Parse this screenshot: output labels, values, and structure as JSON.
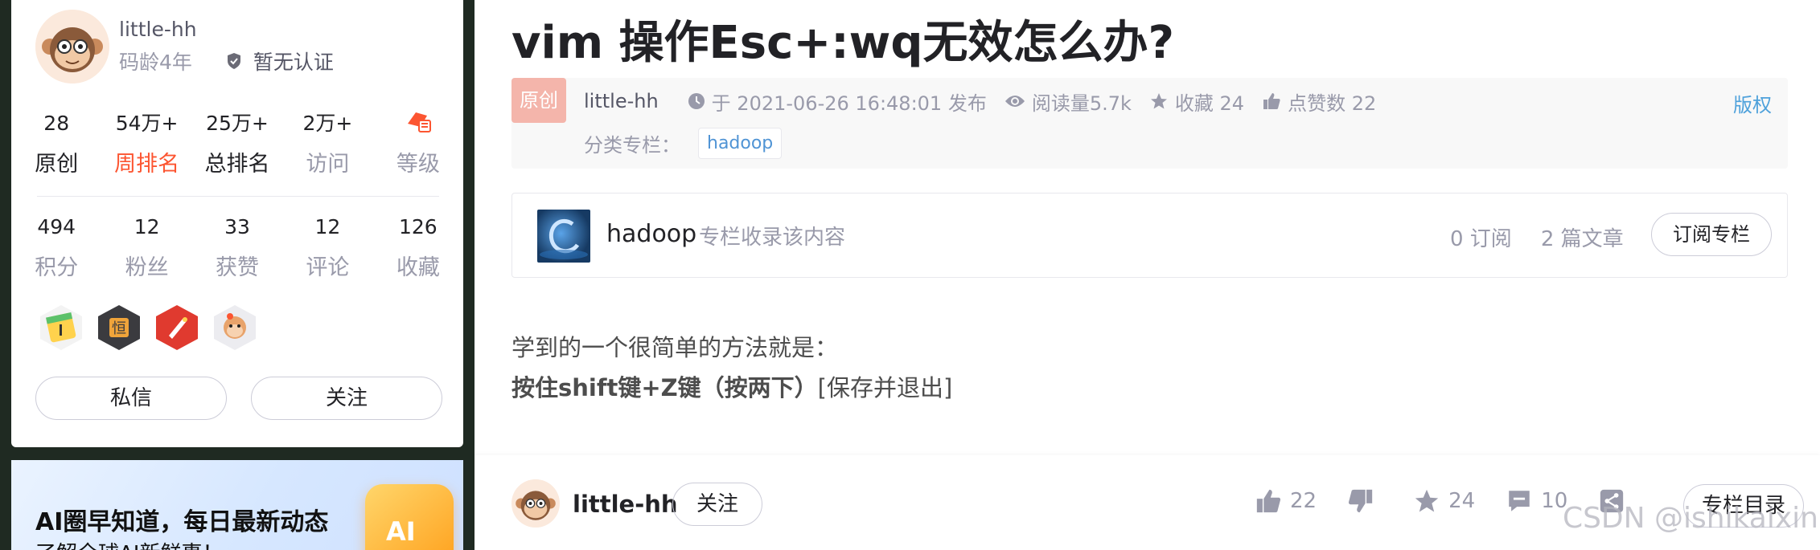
{
  "profile": {
    "name": "little-hh",
    "code_age": "码龄4年",
    "cert": "暂无认证",
    "stats_row1": [
      {
        "num": "28",
        "label": "原创",
        "style": "dark"
      },
      {
        "num": "54万+",
        "label": "周排名",
        "style": "red"
      },
      {
        "num": "25万+",
        "label": "总排名",
        "style": "dark"
      },
      {
        "num": "2万+",
        "label": "访问",
        "style": "gray"
      },
      {
        "num": "",
        "label": "等级",
        "style": "gray"
      }
    ],
    "stats_row2": [
      {
        "num": "494",
        "label": "积分"
      },
      {
        "num": "12",
        "label": "粉丝"
      },
      {
        "num": "33",
        "label": "获赞"
      },
      {
        "num": "12",
        "label": "评论"
      },
      {
        "num": "126",
        "label": "收藏"
      }
    ],
    "message_btn": "私信",
    "follow_btn": "关注"
  },
  "banner": {
    "title": "AI圈早知道，每日最新动态",
    "subtitle": "了解全球AI新鲜事！",
    "cube_text": "AI"
  },
  "article": {
    "title": "vim 操作Esc+:wq无效怎么办?",
    "original_tag": "原创",
    "author": "little-hh",
    "published": "于 2021-06-26 16:48:01 发布",
    "views": "阅读量5.7k",
    "favorites": "收藏 24",
    "likes": "点赞数 22",
    "copyright": "版权",
    "category_label": "分类专栏：",
    "category_tag": "hadoop"
  },
  "column": {
    "name": "hadoop",
    "desc": "专栏收录该内容",
    "subscribers": "0 订阅",
    "articles": "2 篇文章",
    "subscribe_btn": "订阅专栏"
  },
  "content": {
    "line1": "学到的一个很简单的方法就是：",
    "line2_bold": "按住shift键+Z键（按两下）",
    "line2_rest": "[保存并退出]"
  },
  "toolbar": {
    "author": "little-hh",
    "follow": "关注",
    "like_count": "22",
    "fav_count": "24",
    "comment_count": "10",
    "toc_btn": "专栏目录",
    "watermark": "CSDN @ishikaixin"
  },
  "colors": {
    "accent_red": "#fc5531",
    "link_blue": "#5094d5",
    "original_tag": "#f4b5ab"
  }
}
